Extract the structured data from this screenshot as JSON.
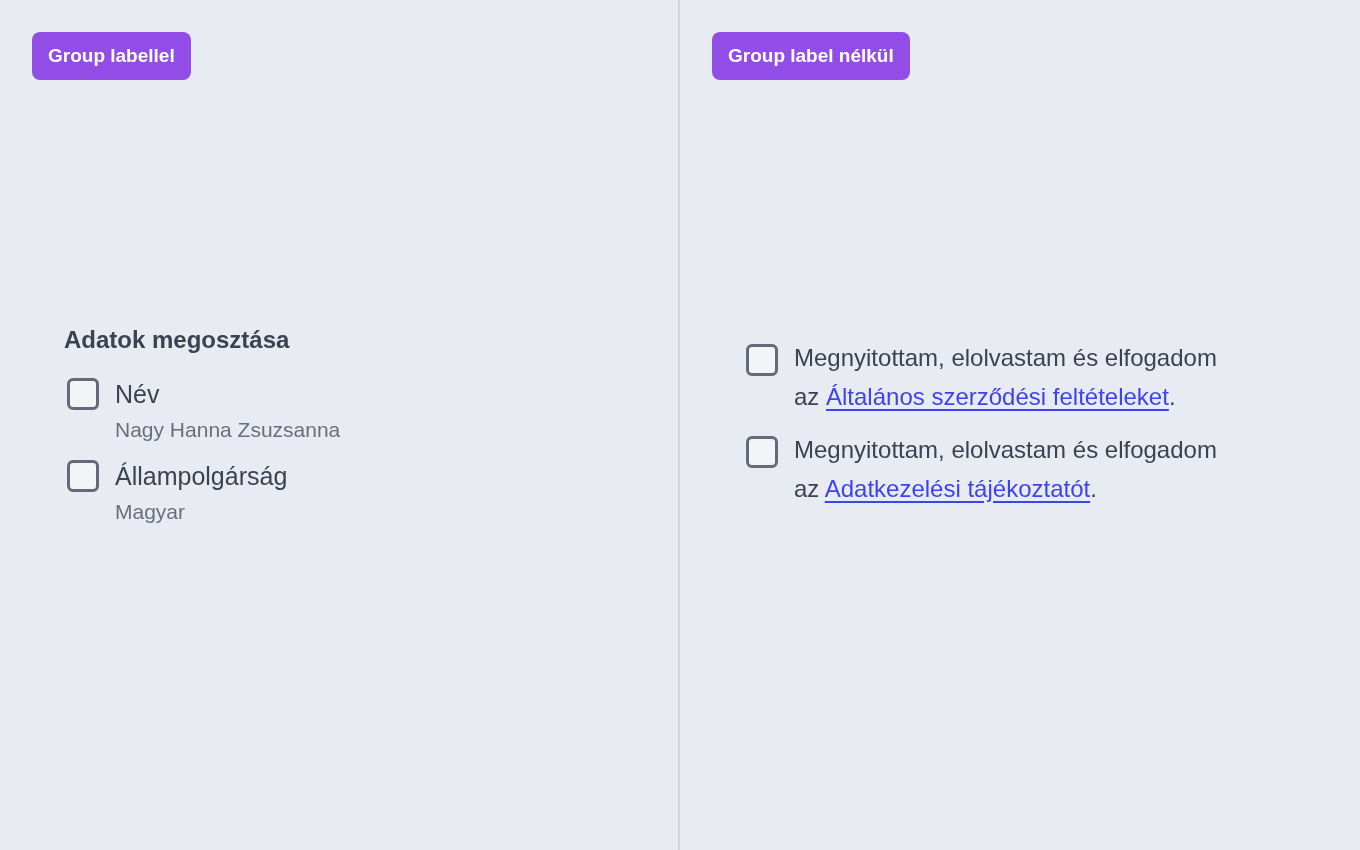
{
  "panels": [
    {
      "badge": "Group labellel",
      "group_label": "Adatok megosztása",
      "items": [
        {
          "label": "Név",
          "description": "Nagy Hanna Zsuzsanna",
          "checked": false
        },
        {
          "label": "Állampolgárság",
          "description": "Magyar",
          "checked": false
        }
      ]
    },
    {
      "badge": "Group label nélkül",
      "consents": [
        {
          "line_1": "Megnyitottam, elolvastam és elfogadom",
          "prefix": "az",
          "link": "Általános szerződési feltételeket",
          "suffix": ".",
          "checked": false
        },
        {
          "line_1": "Megnyitottam, elolvastam és elfogadom",
          "prefix": "az",
          "link": "Adatkezelési tájékoztatót",
          "suffix": ".",
          "checked": false
        }
      ]
    }
  ]
}
